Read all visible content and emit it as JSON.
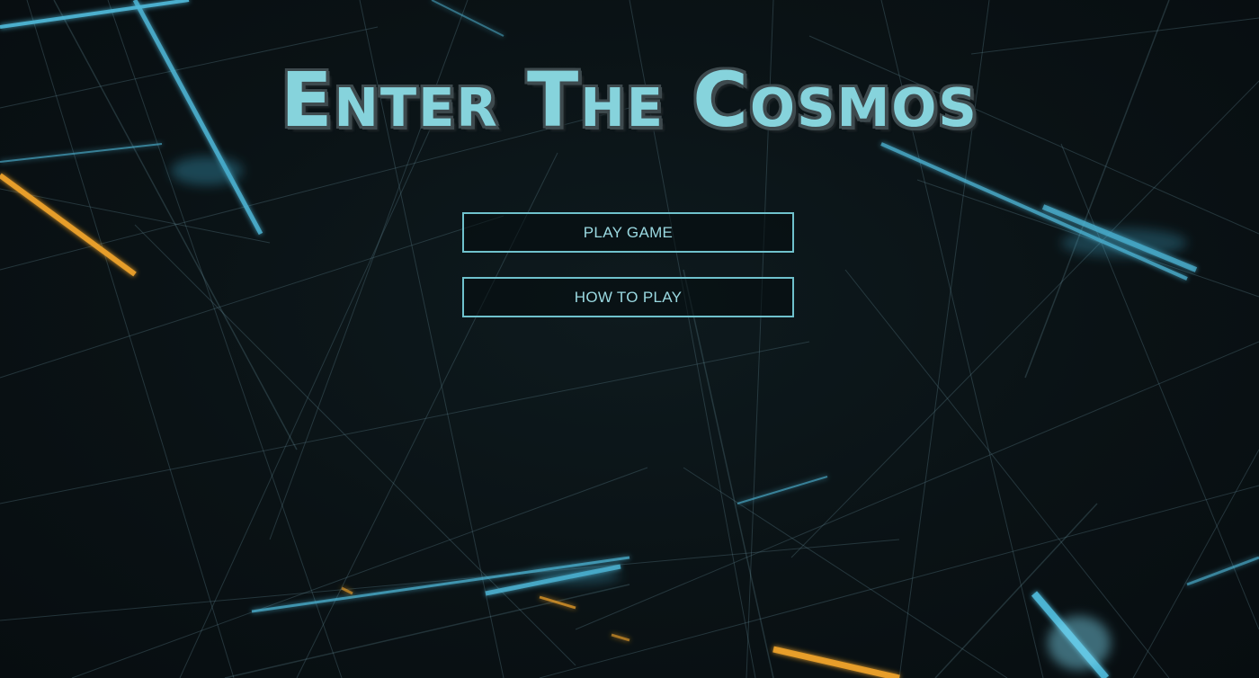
{
  "title": "Enter The Cosmos",
  "menu": {
    "play_label": "PLAY GAME",
    "how_label": "HOW TO PLAY"
  },
  "colors": {
    "title_fill": "#86d3dc",
    "title_outline": "#3e4a4e",
    "button_border": "#6fc1cc",
    "button_text": "#9ad9e1",
    "background": "#0a1215",
    "line_blue": "#4fb8d8",
    "line_orange": "#f0a32a"
  }
}
